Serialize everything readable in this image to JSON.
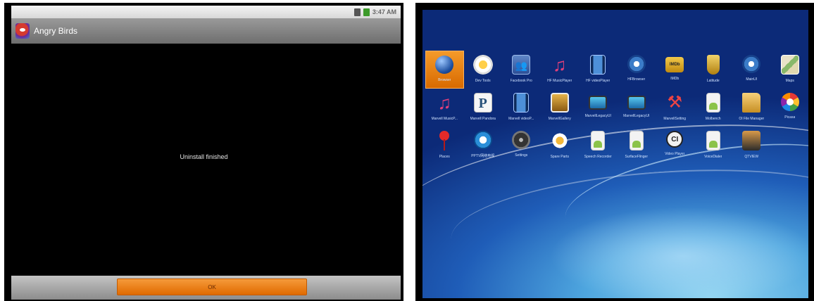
{
  "left": {
    "status_time": "3:47 AM",
    "title": "Angry Birds",
    "message": "Uninstall finished",
    "ok_label": "OK"
  },
  "right": {
    "apps": [
      {
        "label": "Browser",
        "icon": "browser-icon",
        "cls": "ic-globe",
        "selected": true
      },
      {
        "label": "Dev Tools",
        "icon": "dev-tools-icon",
        "cls": "ic-gear"
      },
      {
        "label": "Facebook Pro",
        "icon": "facebook-pro-icon",
        "cls": "ic-fb"
      },
      {
        "label": "HF MusicPlayer",
        "icon": "music-player-icon",
        "cls": "ic-note"
      },
      {
        "label": "HF videoPlayer",
        "icon": "video-player-icon",
        "cls": "ic-film"
      },
      {
        "label": "HFBrowser",
        "icon": "hf-browser-icon",
        "cls": "ic-wave"
      },
      {
        "label": "IMDb",
        "icon": "imdb-icon",
        "cls": "ic-imdb"
      },
      {
        "label": "Latitude",
        "icon": "latitude-icon",
        "cls": "ic-pin"
      },
      {
        "label": "MainUI",
        "icon": "main-ui-icon",
        "cls": "ic-wave"
      },
      {
        "label": "Maps",
        "icon": "maps-icon",
        "cls": "ic-map"
      },
      {
        "label": "Marvell MusicP...",
        "icon": "marvell-music-icon",
        "cls": "ic-note"
      },
      {
        "label": "Marvell Pandora",
        "icon": "pandora-icon",
        "cls": "ic-p"
      },
      {
        "label": "Marvell videoP...",
        "icon": "marvell-video-icon",
        "cls": "ic-film"
      },
      {
        "label": "MarvellGallery",
        "icon": "gallery-icon",
        "cls": "ic-photo"
      },
      {
        "label": "MarvellLegacyUI",
        "icon": "legacy-ui-icon",
        "cls": "ic-monitor"
      },
      {
        "label": "MarvellLegacyUI",
        "icon": "legacy-ui-icon",
        "cls": "ic-monitor"
      },
      {
        "label": "MarvellSetting",
        "icon": "tools-icon",
        "cls": "ic-tools"
      },
      {
        "label": "Molbench",
        "icon": "android-app-icon",
        "cls": "ic-android"
      },
      {
        "label": "OI File Manager",
        "icon": "folder-icon",
        "cls": "ic-folder"
      },
      {
        "label": "Picasa",
        "icon": "picasa-icon",
        "cls": "ic-picasa"
      },
      {
        "label": "Places",
        "icon": "places-icon",
        "cls": "ic-place"
      },
      {
        "label": "PPTV网络电视",
        "icon": "pptv-icon",
        "cls": "ic-pptv"
      },
      {
        "label": "Settings",
        "icon": "settings-icon",
        "cls": "ic-knob"
      },
      {
        "label": "Spare Parts",
        "icon": "spare-parts-icon",
        "cls": "ic-flower"
      },
      {
        "label": "Speech Recorder",
        "icon": "android-app-icon",
        "cls": "ic-android"
      },
      {
        "label": "SurfaceFlinger",
        "icon": "android-app-icon",
        "cls": "ic-android"
      },
      {
        "label": "Video Player",
        "icon": "ci-video-player-icon",
        "cls": "ic-ci"
      },
      {
        "label": "VoiceDialer",
        "icon": "android-app-icon",
        "cls": "ic-android"
      },
      {
        "label": "QTVIEW",
        "icon": "airplane-icon",
        "cls": "ic-plane"
      }
    ]
  }
}
